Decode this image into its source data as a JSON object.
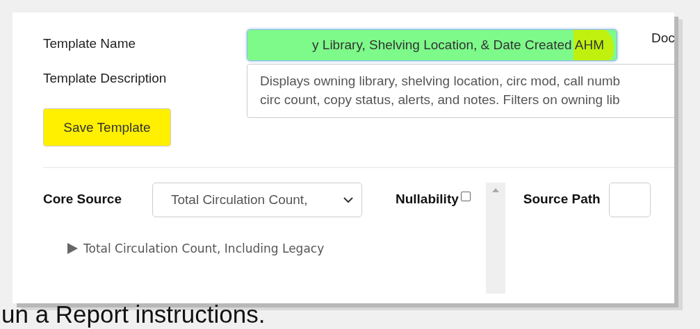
{
  "template_name": {
    "label": "Template Name",
    "value": "y Library, Shelving Location, & Date Created AHM",
    "highlighted": true
  },
  "doc_label": "Doc",
  "template_description": {
    "label": "Template Description",
    "lines": [
      "Displays owning library, shelving location, circ mod, call numb",
      "circ count, copy status, alerts, and notes. Filters on owning lib"
    ]
  },
  "save_button": {
    "label": "Save Template",
    "highlighted": true
  },
  "core_source": {
    "label": "Core Source",
    "value": "Total Circulation Count,"
  },
  "nullability": {
    "label": "Nullability",
    "checked": false
  },
  "source_path": {
    "label": "Source Path"
  },
  "tree": [
    {
      "label": "Total Circulation Count, Including Legacy",
      "expanded": false
    }
  ],
  "caption": "un a Report instructions."
}
